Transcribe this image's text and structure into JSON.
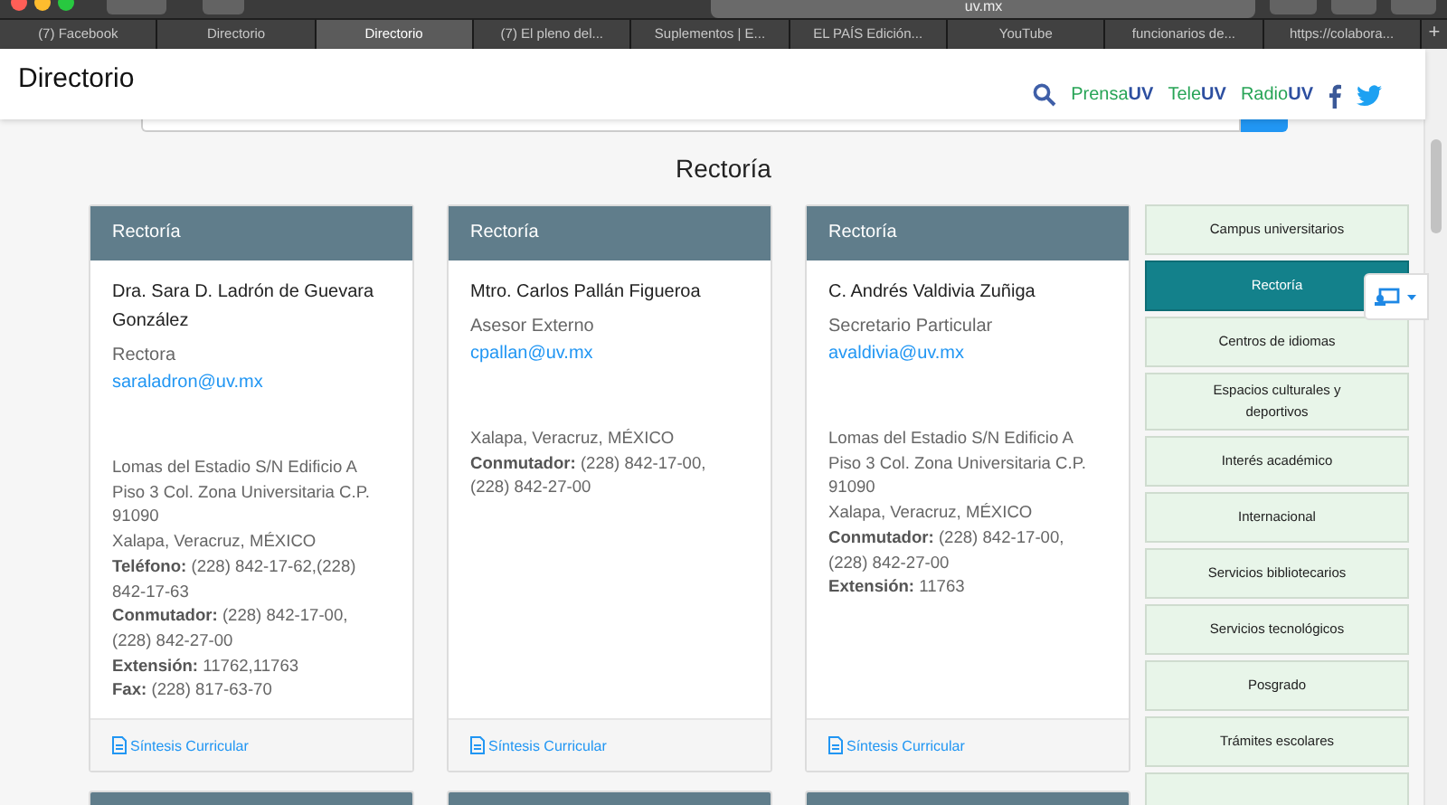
{
  "browser": {
    "address": "uv.mx",
    "tabs": [
      {
        "label": "(7) Facebook",
        "selected": false
      },
      {
        "label": "Directorio",
        "selected": false
      },
      {
        "label": "Directorio",
        "selected": true
      },
      {
        "label": "(7) El pleno del...",
        "selected": false
      },
      {
        "label": "Suplementos | E...",
        "selected": false
      },
      {
        "label": "EL PAÍS Edición...",
        "selected": false
      },
      {
        "label": "YouTube",
        "selected": false
      },
      {
        "label": "funcionarios de...",
        "selected": false
      },
      {
        "label": "https://colabora...",
        "selected": false
      }
    ],
    "new_tab": "+"
  },
  "header": {
    "title": "Directorio",
    "brands": [
      {
        "prefix": "Prensa",
        "suffix": "UV"
      },
      {
        "prefix": "Tele",
        "suffix": "UV"
      },
      {
        "prefix": "Radio",
        "suffix": "UV"
      }
    ]
  },
  "section_title": "Rectoría",
  "cards": [
    {
      "header": "Rectoría",
      "name": "Dra. Sara D. Ladrón de Guevara González",
      "role": "Rectora",
      "email": "saraladron@uv.mx",
      "details": [
        {
          "text": "Lomas del Estadio S/N Edificio A Piso 3 Col. Zona Universitaria C.P. 91090"
        },
        {
          "text": "Xalapa, Veracruz, MÉXICO"
        },
        {
          "label": "Teléfono:",
          "text": "(228) 842-17-62,(228) 842-17-63"
        },
        {
          "label": "Conmutador:",
          "text": "(228) 842-17-00, (228) 842-27-00"
        },
        {
          "label": "Extensión:",
          "text": "11762,11763"
        },
        {
          "label": "Fax:",
          "text": "(228) 817-63-70"
        }
      ],
      "link": "Síntesis Curricular"
    },
    {
      "header": "Rectoría",
      "name": "Mtro. Carlos Pallán Figueroa",
      "role": "Asesor Externo",
      "email": "cpallan@uv.mx",
      "details": [
        {
          "text": "Xalapa, Veracruz, MÉXICO"
        },
        {
          "label": "Conmutador:",
          "text": "(228) 842-17-00, (228) 842-27-00"
        }
      ],
      "link": "Síntesis Curricular"
    },
    {
      "header": "Rectoría",
      "name": "C. Andrés Valdivia Zuñiga",
      "role": "Secretario Particular",
      "email": "avaldivia@uv.mx",
      "details": [
        {
          "text": "Lomas del Estadio S/N Edificio A Piso 3 Col. Zona Universitaria C.P. 91090"
        },
        {
          "text": "Xalapa, Veracruz, MÉXICO"
        },
        {
          "label": "Conmutador:",
          "text": "(228) 842-17-00, (228) 842-27-00"
        },
        {
          "label": "Extensión:",
          "text": "11763"
        }
      ],
      "link": "Síntesis Curricular"
    }
  ],
  "menu": [
    {
      "label": "Campus universitarios",
      "selected": false
    },
    {
      "label": "Rectoría",
      "selected": true
    },
    {
      "label": "Centros de idiomas",
      "selected": false
    },
    {
      "label": "Espacios culturales y deportivos",
      "selected": false
    },
    {
      "label": "Interés académico",
      "selected": false
    },
    {
      "label": "Internacional",
      "selected": false
    },
    {
      "label": "Servicios bibliotecarios",
      "selected": false
    },
    {
      "label": "Servicios tecnológicos",
      "selected": false
    },
    {
      "label": "Posgrado",
      "selected": false
    },
    {
      "label": "Trámites escolares",
      "selected": false
    }
  ]
}
